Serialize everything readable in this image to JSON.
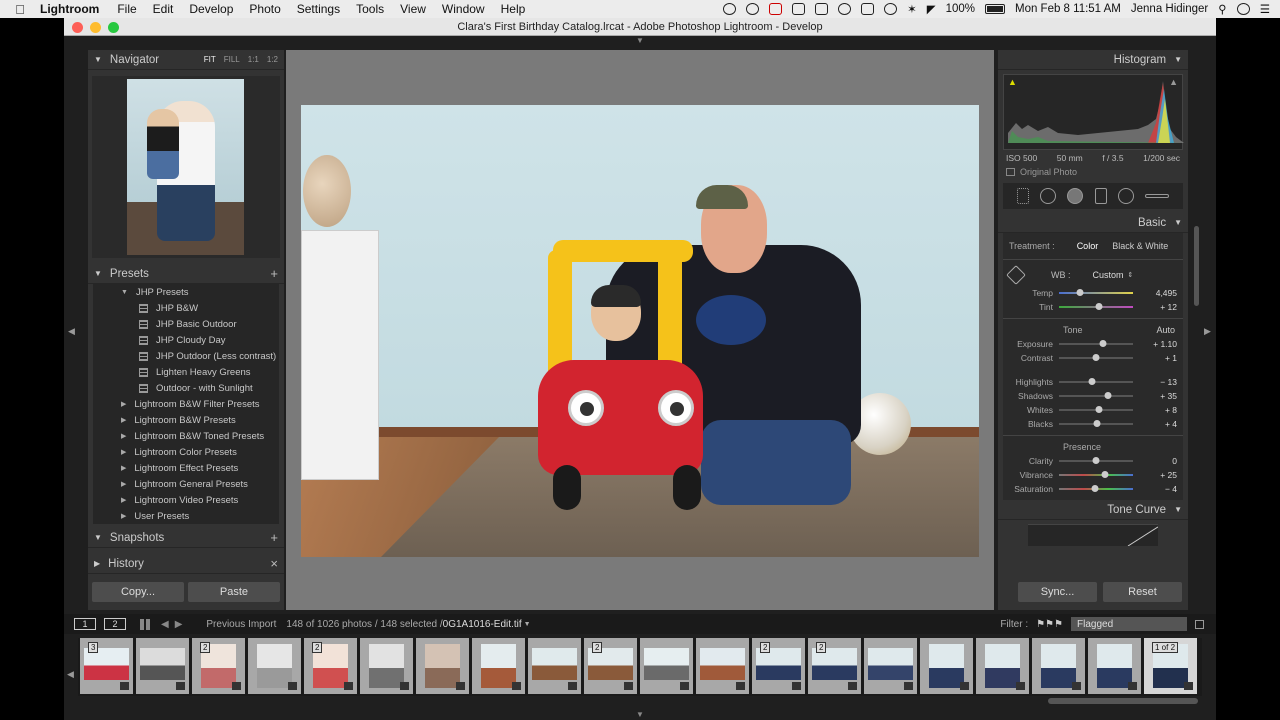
{
  "menubar": {
    "app": "Lightroom",
    "menus": [
      "File",
      "Edit",
      "Develop",
      "Photo",
      "Settings",
      "Tools",
      "View",
      "Window",
      "Help"
    ],
    "battery": "100%",
    "datetime": "Mon Feb 8  11:51 AM",
    "user": "Jenna Hidinger"
  },
  "window": {
    "title": "Clara's First Birthday Catalog.lrcat - Adobe Photoshop Lightroom - Develop"
  },
  "navigator": {
    "title": "Navigator",
    "zoom": [
      "FIT",
      "FILL",
      "1:1",
      "1:2"
    ]
  },
  "presets": {
    "title": "Presets",
    "open_folder": "JHP Presets",
    "items": [
      "JHP B&W",
      "JHP Basic Outdoor",
      "JHP Cloudy Day",
      "JHP Outdoor (Less contrast)",
      "Lighten Heavy Greens",
      "Outdoor - with Sunlight"
    ],
    "folders": [
      "Lightroom B&W Filter Presets",
      "Lightroom B&W Presets",
      "Lightroom B&W Toned Presets",
      "Lightroom Color Presets",
      "Lightroom Effect Presets",
      "Lightroom General Presets",
      "Lightroom Video Presets",
      "User Presets"
    ]
  },
  "snapshots": {
    "title": "Snapshots"
  },
  "history": {
    "title": "History"
  },
  "left_buttons": {
    "copy": "Copy...",
    "paste": "Paste"
  },
  "histogram": {
    "title": "Histogram",
    "iso": "ISO 500",
    "focal": "50 mm",
    "aperture": "f / 3.5",
    "shutter": "1/200 sec",
    "original_photo": "Original Photo"
  },
  "basic": {
    "title": "Basic",
    "treatment_label": "Treatment :",
    "treatment_color": "Color",
    "treatment_bw": "Black & White",
    "wb_label": "WB :",
    "wb_value": "Custom",
    "temp": {
      "label": "Temp",
      "value": "4,495",
      "pos": 0.28
    },
    "tint": {
      "label": "Tint",
      "value": "+ 12",
      "pos": 0.54
    },
    "tone_label": "Tone",
    "auto_label": "Auto",
    "exposure": {
      "label": "Exposure",
      "value": "+ 1.10",
      "pos": 0.6
    },
    "contrast": {
      "label": "Contrast",
      "value": "+ 1",
      "pos": 0.5
    },
    "highlights": {
      "label": "Highlights",
      "value": "− 13",
      "pos": 0.44
    },
    "shadows": {
      "label": "Shadows",
      "value": "+ 35",
      "pos": 0.66
    },
    "whites": {
      "label": "Whites",
      "value": "+ 8",
      "pos": 0.54
    },
    "blacks": {
      "label": "Blacks",
      "value": "+ 4",
      "pos": 0.52
    },
    "presence_label": "Presence",
    "clarity": {
      "label": "Clarity",
      "value": "0",
      "pos": 0.5
    },
    "vibrance": {
      "label": "Vibrance",
      "value": "+ 25",
      "pos": 0.62
    },
    "saturation": {
      "label": "Saturation",
      "value": "− 4",
      "pos": 0.48
    }
  },
  "tone_curve": {
    "title": "Tone Curve"
  },
  "right_buttons": {
    "sync": "Sync...",
    "reset": "Reset"
  },
  "toolbar": {
    "view1": "1",
    "view2": "2",
    "source": "Previous Import",
    "count": "148 of 1026 photos / 148 selected /",
    "filename": "0G1A1016-Edit.tif",
    "filter_label": "Filter :",
    "filter_value": "Flagged"
  },
  "filmstrip": {
    "frames": [
      {
        "stack": "3",
        "wide": true,
        "colors": [
          "#e6eef2",
          "#cc3344"
        ]
      },
      {
        "stack": "",
        "wide": true,
        "colors": [
          "#dcdcdc",
          "#555555"
        ]
      },
      {
        "stack": "2",
        "wide": false,
        "colors": [
          "#efe4dc",
          "#c26a6a"
        ]
      },
      {
        "stack": "",
        "wide": false,
        "colors": [
          "#e6e6e6",
          "#9a9a9a"
        ]
      },
      {
        "stack": "2",
        "wide": false,
        "colors": [
          "#f2e2d8",
          "#d05050"
        ]
      },
      {
        "stack": "",
        "wide": false,
        "colors": [
          "#e2e2e2",
          "#707070"
        ]
      },
      {
        "stack": "",
        "wide": false,
        "colors": [
          "#d4c2b4",
          "#8a6a58"
        ]
      },
      {
        "stack": "",
        "wide": false,
        "colors": [
          "#e4ecee",
          "#a55a3a"
        ]
      },
      {
        "stack": "",
        "wide": true,
        "colors": [
          "#e0eaec",
          "#8a5a3a"
        ]
      },
      {
        "stack": "2",
        "wide": true,
        "colors": [
          "#e2eaec",
          "#8a5a3a"
        ]
      },
      {
        "stack": "",
        "wide": true,
        "colors": [
          "#e6eef0",
          "#6a6a6a"
        ]
      },
      {
        "stack": "",
        "wide": true,
        "colors": [
          "#e2eaee",
          "#a05a3a"
        ]
      },
      {
        "stack": "2",
        "wide": true,
        "colors": [
          "#dfe9ec",
          "#2a3a60"
        ]
      },
      {
        "stack": "2",
        "wide": true,
        "colors": [
          "#dfe9ec",
          "#2a3a60"
        ]
      },
      {
        "stack": "",
        "wide": true,
        "colors": [
          "#dfe9ec",
          "#34446a"
        ]
      },
      {
        "stack": "",
        "wide": false,
        "colors": [
          "#dfe9ec",
          "#2a3a60"
        ]
      },
      {
        "stack": "",
        "wide": false,
        "colors": [
          "#dfe9ec",
          "#303a60"
        ]
      },
      {
        "stack": "",
        "wide": false,
        "colors": [
          "#dfe9ec",
          "#2a3a60"
        ]
      },
      {
        "stack": "",
        "wide": false,
        "colors": [
          "#dfe9ec",
          "#2a3a60"
        ]
      },
      {
        "stack": "1 of 2",
        "wide": false,
        "colors": [
          "#dfe9ec",
          "#22304e"
        ],
        "selected": true
      }
    ]
  }
}
